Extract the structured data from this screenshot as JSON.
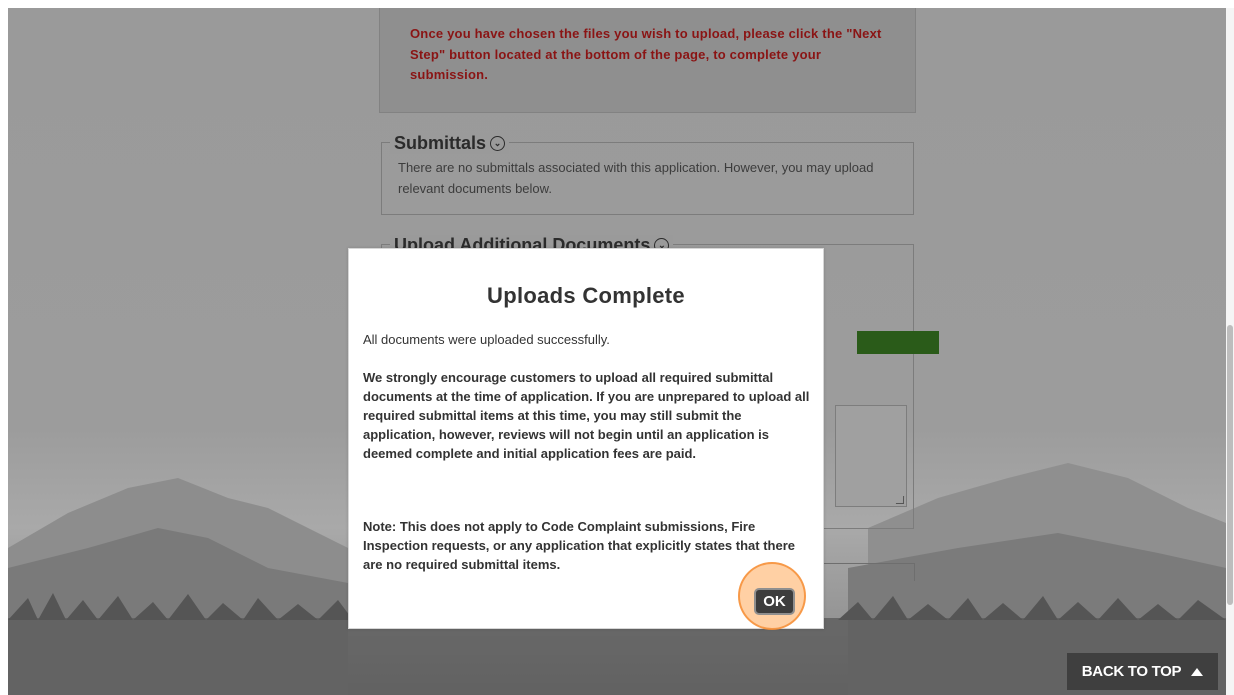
{
  "page": {
    "notice": "Once you have chosen the files you wish to upload, please click the \"Next Step\" button located at the bottom of the page, to complete your submission."
  },
  "submittals": {
    "title": "Submittals",
    "text": "There are no submittals associated with this application. However, you may upload relevant documents below.",
    "icon": "chevron-down-circle-icon"
  },
  "upload_section": {
    "title": "Upload Additional Documents",
    "icon": "chevron-down-circle-icon",
    "progress_color": "#2a5b19"
  },
  "modal": {
    "title": "Uploads Complete",
    "message": "All documents were uploaded successfully.",
    "paragraph1": "We strongly encourage customers to upload all required submittal documents at the time of application. If you are unprepared to upload all required submittal items at this time, you may still submit the application, however, reviews will not begin until an application is deemed complete and initial application fees are paid.",
    "paragraph2": "Note: This does not apply to Code Complaint submissions, Fire Inspection requests, or any application that explicitly states that there are no required submittal items.",
    "ok_label": "OK"
  },
  "footer": {
    "back_to_top_label": "BACK TO TOP",
    "back_to_top_icon": "triangle-up-icon"
  },
  "colors": {
    "notice_text": "#8a1414",
    "overlay": "#9a9a9a",
    "highlight": "#f5a05a"
  }
}
